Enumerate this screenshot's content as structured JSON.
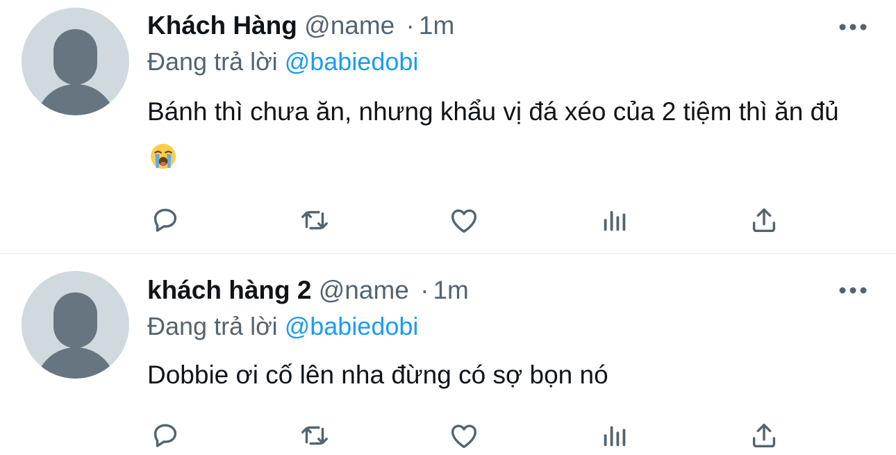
{
  "tweets": [
    {
      "name": "Khách Hàng",
      "handle": "@name",
      "separator": "·",
      "time": "1m",
      "reply_prefix": "Đang trả lời",
      "reply_to": "@babiedobi",
      "text": "Bánh thì chưa ăn, nhưng khẩu vị đá xéo của 2 tiệm thì ăn đủ",
      "emoji": "loudly-crying-face"
    },
    {
      "name": "khách hàng 2",
      "handle": "@name",
      "separator": "·",
      "time": "1m",
      "reply_prefix": "Đang trả lời",
      "reply_to": "@babiedobi",
      "text": "Dobbie ơi cố lên nha đừng có sợ bọn nó"
    }
  ],
  "icons": [
    "more-icon",
    "reply-icon",
    "retweet-icon",
    "like-icon",
    "analytics-icon",
    "share-icon"
  ],
  "colors": {
    "accent": "#1d9bf0",
    "secondary_text": "#536471",
    "icon": "#536471",
    "avatar_bg": "#cfd9de",
    "avatar_fg": "#66757f"
  }
}
